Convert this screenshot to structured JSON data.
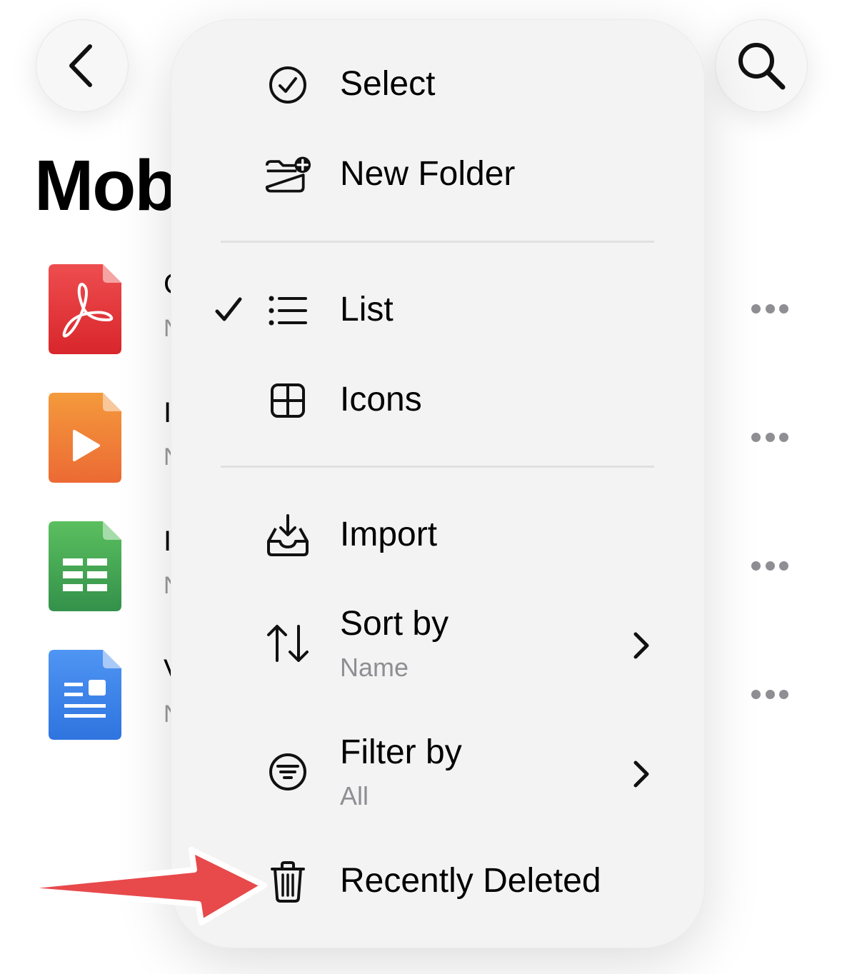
{
  "header": {
    "title": "Mob",
    "back_icon": "chevron-left-icon",
    "search_icon": "search-icon"
  },
  "files": [
    {
      "name_peek": "C",
      "meta_peek": "N",
      "icon": "pdf-file-icon",
      "color": "#e0353a"
    },
    {
      "name_peek": "I",
      "meta_peek": "N",
      "icon": "video-file-icon",
      "color": "#f07a35"
    },
    {
      "name_peek": "I",
      "meta_peek": "N",
      "icon": "spreadsheet-file-icon",
      "color": "#3a9d4a"
    },
    {
      "name_peek": "V",
      "meta_peek": "N",
      "icon": "document-file-icon",
      "color": "#3c82ea"
    }
  ],
  "menu": {
    "select": {
      "label": "Select",
      "icon": "checkmark-circle-icon"
    },
    "new_folder": {
      "label": "New Folder",
      "icon": "folder-plus-icon"
    },
    "list": {
      "label": "List",
      "icon": "list-icon",
      "checked": true
    },
    "icons": {
      "label": "Icons",
      "icon": "grid-icon"
    },
    "import": {
      "label": "Import",
      "icon": "tray-download-icon"
    },
    "sort_by": {
      "label": "Sort by",
      "value": "Name",
      "icon": "sort-arrows-icon"
    },
    "filter_by": {
      "label": "Filter by",
      "value": "All",
      "icon": "filter-circle-icon"
    },
    "recently_deleted": {
      "label": "Recently Deleted",
      "icon": "trash-icon"
    }
  },
  "annotation": {
    "color": "#e8494b"
  }
}
